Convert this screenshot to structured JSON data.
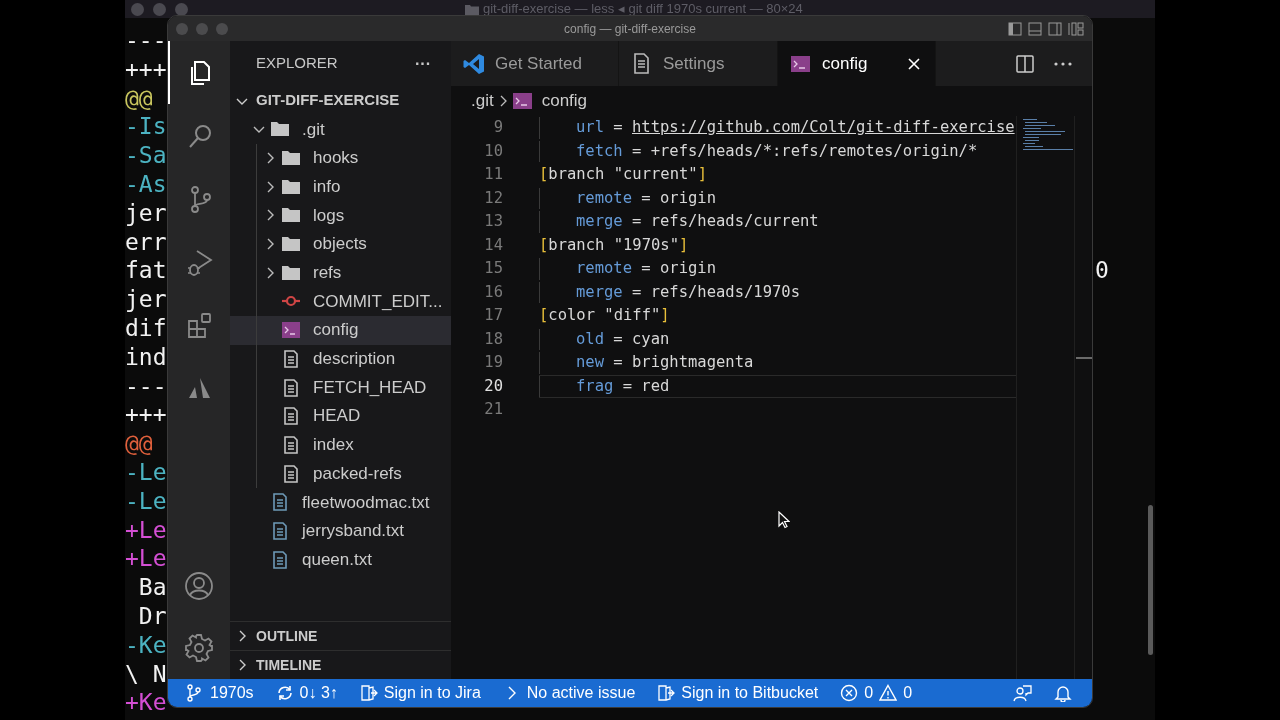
{
  "terminal": {
    "title": "git-diff-exercise — less ◂ git diff 1970s current — 80×24",
    "lines": [
      {
        "text": "---",
        "color": "#f2f2f2"
      },
      {
        "text": "+++",
        "color": "#f2f2f2"
      },
      {
        "text": "@@",
        "color": "#c9c65e"
      },
      {
        "text": "-Is",
        "color": "#4cb3c2"
      },
      {
        "text": "-Sa",
        "color": "#4cb3c2"
      },
      {
        "text": "-As",
        "color": "#4cb3c2"
      },
      {
        "text": "jer",
        "color": "#f2f2f2"
      },
      {
        "text": "err",
        "color": "#f2f2f2"
      },
      {
        "text": "fat",
        "color": "#f2f2f2",
        "tail": "0"
      },
      {
        "text": "jer",
        "color": "#f2f2f2"
      },
      {
        "text": "dif",
        "color": "#f2f2f2"
      },
      {
        "text": "ind",
        "color": "#f2f2f2"
      },
      {
        "text": "---",
        "color": "#f2f2f2"
      },
      {
        "text": "+++",
        "color": "#f2f2f2"
      },
      {
        "text": "@@",
        "color": "#e0603c"
      },
      {
        "text": "-Le",
        "color": "#4cb3c2"
      },
      {
        "text": "-Le",
        "color": "#4cb3c2"
      },
      {
        "text": "+Le",
        "color": "#d44fd4"
      },
      {
        "text": "+Le",
        "color": "#d44fd4"
      },
      {
        "text": " Ba",
        "color": "#f2f2f2"
      },
      {
        "text": " Dr",
        "color": "#f2f2f2"
      },
      {
        "text": "-Ke",
        "color": "#4cb3c2"
      },
      {
        "text": "\\ N",
        "color": "#f2f2f2"
      },
      {
        "text": "+Ke",
        "color": "#d44fd4"
      }
    ]
  },
  "window": {
    "title": "config — git-diff-exercise"
  },
  "activity_bar": [
    {
      "kind": "files",
      "selected": true
    },
    {
      "kind": "search",
      "selected": false
    },
    {
      "kind": "source-control",
      "selected": false
    },
    {
      "kind": "run",
      "selected": false
    },
    {
      "kind": "extensions",
      "selected": false
    },
    {
      "kind": "atlassian",
      "selected": false
    }
  ],
  "sidebar": {
    "title": "EXPLORER",
    "more": "···",
    "root": {
      "label": "GIT-DIFF-EXERCISE",
      "expanded": true,
      "children": [
        {
          "label": ".git",
          "kind": "folder",
          "expanded": true,
          "selected": false,
          "children": [
            {
              "label": "hooks",
              "kind": "folder",
              "expanded": false,
              "selected": false
            },
            {
              "label": "info",
              "kind": "folder",
              "expanded": false,
              "selected": false
            },
            {
              "label": "logs",
              "kind": "folder",
              "expanded": false,
              "selected": false
            },
            {
              "label": "objects",
              "kind": "folder",
              "expanded": false,
              "selected": false
            },
            {
              "label": "refs",
              "kind": "folder",
              "expanded": false,
              "selected": false
            },
            {
              "label": "COMMIT_EDIT...",
              "kind": "git",
              "selected": false
            },
            {
              "label": "config",
              "kind": "terminal",
              "selected": true
            },
            {
              "label": "description",
              "kind": "file",
              "selected": false
            },
            {
              "label": "FETCH_HEAD",
              "kind": "file",
              "selected": false
            },
            {
              "label": "HEAD",
              "kind": "file",
              "selected": false
            },
            {
              "label": "index",
              "kind": "file",
              "selected": false
            },
            {
              "label": "packed-refs",
              "kind": "file",
              "selected": false
            }
          ]
        },
        {
          "label": "fleetwoodmac.txt",
          "kind": "text",
          "selected": false
        },
        {
          "label": "jerrysband.txt",
          "kind": "text",
          "selected": false
        },
        {
          "label": "queen.txt",
          "kind": "text",
          "selected": false
        }
      ]
    },
    "sections": [
      {
        "label": "OUTLINE",
        "expanded": false
      },
      {
        "label": "TIMELINE",
        "expanded": false
      }
    ]
  },
  "tabs": [
    {
      "label": "Get Started",
      "kind": "vscode",
      "selected": false
    },
    {
      "label": "Settings",
      "kind": "document",
      "selected": false
    },
    {
      "label": "config",
      "kind": "terminal",
      "selected": true
    }
  ],
  "breadcrumb": [
    {
      "label": ".git"
    },
    {
      "label": "config",
      "kind": "terminal"
    }
  ],
  "editor": {
    "lines": [
      {
        "number": "9",
        "indented": true,
        "current": false,
        "tokens": [
          {
            "text": "url",
            "kind": "key"
          },
          {
            "text": " = ",
            "kind": "plain"
          },
          {
            "text": "https://github.com/Colt/git-diff-exercise",
            "kind": "link"
          }
        ]
      },
      {
        "number": "10",
        "indented": true,
        "current": false,
        "tokens": [
          {
            "text": "fetch",
            "kind": "key"
          },
          {
            "text": " = +refs/heads/*:refs/remotes/origin/*",
            "kind": "plain"
          }
        ]
      },
      {
        "number": "11",
        "indented": false,
        "current": false,
        "tokens": [
          {
            "text": "[",
            "kind": "bracket"
          },
          {
            "text": "branch \"current\"",
            "kind": "plain"
          },
          {
            "text": "]",
            "kind": "bracket"
          }
        ]
      },
      {
        "number": "12",
        "indented": true,
        "current": false,
        "tokens": [
          {
            "text": "remote",
            "kind": "key"
          },
          {
            "text": " = origin",
            "kind": "plain"
          }
        ]
      },
      {
        "number": "13",
        "indented": true,
        "current": false,
        "tokens": [
          {
            "text": "merge",
            "kind": "key"
          },
          {
            "text": " = refs/heads/current",
            "kind": "plain"
          }
        ]
      },
      {
        "number": "14",
        "indented": false,
        "current": false,
        "tokens": [
          {
            "text": "[",
            "kind": "bracket"
          },
          {
            "text": "branch \"1970s\"",
            "kind": "plain"
          },
          {
            "text": "]",
            "kind": "bracket"
          }
        ]
      },
      {
        "number": "15",
        "indented": true,
        "current": false,
        "tokens": [
          {
            "text": "remote",
            "kind": "key"
          },
          {
            "text": " = origin",
            "kind": "plain"
          }
        ]
      },
      {
        "number": "16",
        "indented": true,
        "current": false,
        "tokens": [
          {
            "text": "merge",
            "kind": "key"
          },
          {
            "text": " = refs/heads/1970s",
            "kind": "plain"
          }
        ]
      },
      {
        "number": "17",
        "indented": false,
        "current": false,
        "tokens": [
          {
            "text": "[",
            "kind": "bracket"
          },
          {
            "text": "color \"diff\"",
            "kind": "plain"
          },
          {
            "text": "]",
            "kind": "bracket"
          }
        ]
      },
      {
        "number": "18",
        "indented": true,
        "current": false,
        "tokens": [
          {
            "text": "old",
            "kind": "key"
          },
          {
            "text": " = cyan",
            "kind": "plain"
          }
        ]
      },
      {
        "number": "19",
        "indented": true,
        "current": false,
        "tokens": [
          {
            "text": "new",
            "kind": "key"
          },
          {
            "text": " = brightmagenta",
            "kind": "plain"
          }
        ]
      },
      {
        "number": "20",
        "indented": true,
        "current": true,
        "tokens": [
          {
            "text": "frag",
            "kind": "key"
          },
          {
            "text": " = red",
            "kind": "plain"
          }
        ]
      },
      {
        "number": "21",
        "indented": false,
        "current": false
      }
    ]
  },
  "status_bar": {
    "items": [
      {
        "kind": "branch",
        "text": "1970s"
      },
      {
        "kind": "sync",
        "text": "0↓ 3↑"
      },
      {
        "kind": "jira",
        "text": "Sign in to Jira"
      },
      {
        "kind": "issue",
        "text": "No active issue"
      },
      {
        "kind": "bitbucket",
        "text": "Sign in to Bitbucket"
      },
      {
        "kind": "problems",
        "errors": "0",
        "warnings": "0"
      }
    ]
  }
}
